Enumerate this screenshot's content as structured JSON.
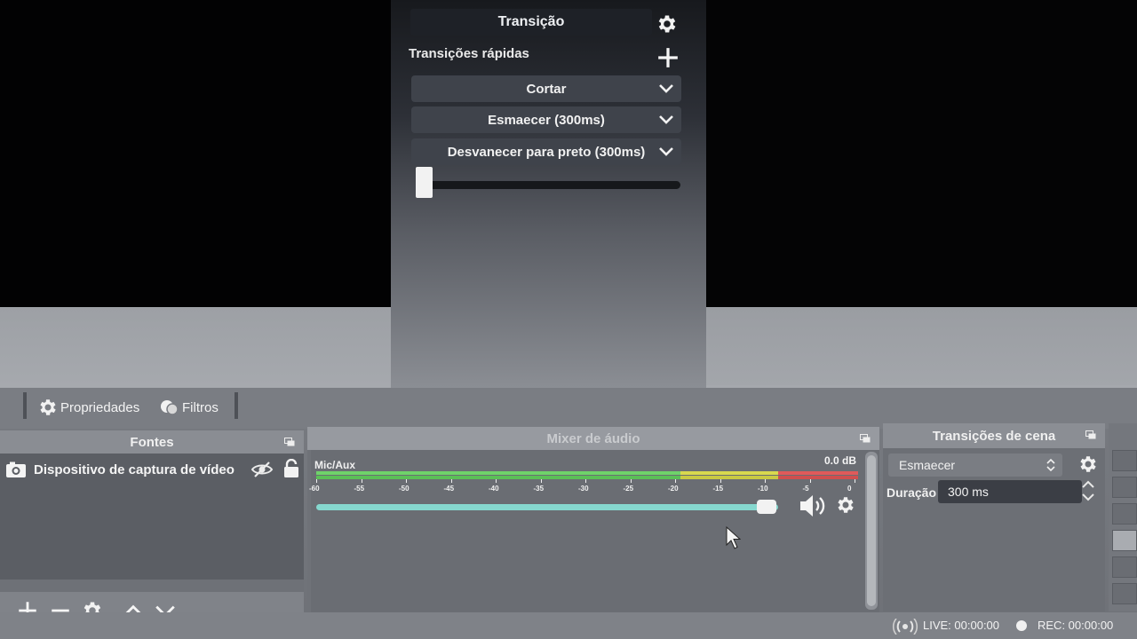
{
  "transition_panel": {
    "title": "Transição",
    "quick_transitions_label": "Transições rápidas",
    "quick_transitions": [
      {
        "label": "Cortar"
      },
      {
        "label": "Esmaecer (300ms)"
      },
      {
        "label": "Desvanecer para preto (300ms)"
      }
    ],
    "tbar_position": 0.0
  },
  "toolbar": {
    "properties_label": "Propriedades",
    "filters_label": "Filtros"
  },
  "sources": {
    "title": "Fontes",
    "items": [
      {
        "name": "Dispositivo de captura de vídeo",
        "visible": false,
        "locked": false
      }
    ]
  },
  "mixer": {
    "title": "Mixer de áudio",
    "channel_name": "Mic/Aux",
    "level_db": "0.0 dB",
    "ticks": [
      "-60",
      "-55",
      "-50",
      "-45",
      "-40",
      "-35",
      "-30",
      "-25",
      "-20",
      "-15",
      "-10",
      "-5",
      "0"
    ],
    "volume": 0.97
  },
  "scene_transitions": {
    "title": "Transições de cena",
    "selected": "Esmaecer",
    "duration_label": "Duração",
    "duration_value": "300 ms"
  },
  "status": {
    "live": "LIVE: 00:00:00",
    "rec": "REC: 00:00:00"
  },
  "colors": {
    "meter_green": "#6fd36a",
    "meter_yellow": "#d9d94e",
    "meter_red": "#e05a5a",
    "volume_track": "#86d8cf"
  }
}
